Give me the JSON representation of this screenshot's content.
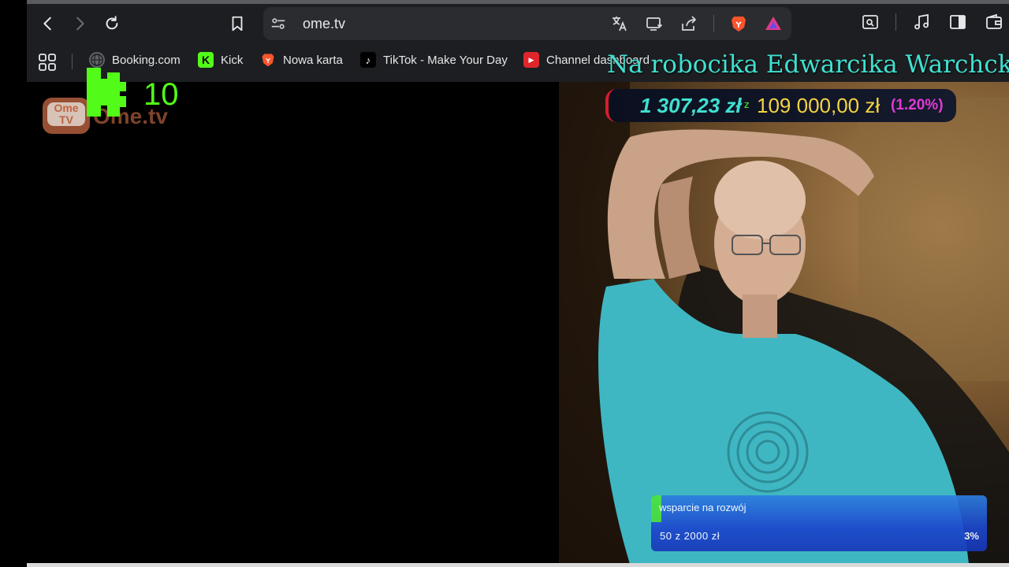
{
  "browser": {
    "url": "ome.tv",
    "bookmarks": [
      {
        "label": "Booking.com",
        "icon": "globe-icon"
      },
      {
        "label": "Kick",
        "icon": "kick-icon"
      },
      {
        "label": "Nowa karta",
        "icon": "brave-icon"
      },
      {
        "label": "TikTok - Make Your Day",
        "icon": "tiktok-icon"
      },
      {
        "label": "Channel dashboard",
        "icon": "youtube-icon"
      }
    ]
  },
  "overlay": {
    "ome_logo_text": "Ome.tv",
    "ome_tv_badge": "Ome",
    "ome_tv_badge_sub": "TV",
    "kick_viewer_count": "10",
    "stream_title": "Na robocika Edwarcika Warchcki",
    "goal": {
      "amount": "1 307,23 zł",
      "separator": "z",
      "target": "109 000,00 zł",
      "percent": "(1.20%)"
    },
    "support": {
      "label": "wsparcie na rozwój",
      "progress_text": "50  z  2000  zł",
      "percent_text": "3%",
      "fraction": 0.03
    }
  },
  "colors": {
    "accent_cyan": "#40e0d0",
    "kick_green": "#53fc18",
    "gold": "#f4d444",
    "magenta": "#e03ad8",
    "bar_blue": "#1c46cc"
  }
}
